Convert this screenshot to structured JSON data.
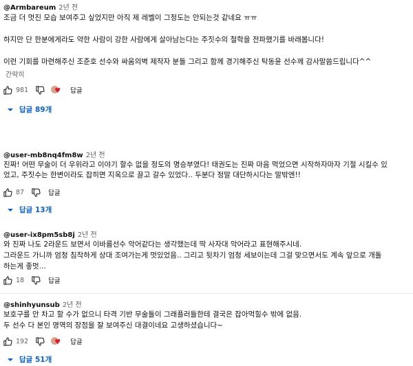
{
  "comments": [
    {
      "author": "@Armbareum",
      "time": "2년 전",
      "lines": [
        "조금 더 멋진 모습 보여주고 싶었지만 아직 제 레벨이 그정도는 안되는것 같네요 ㅠㅠ",
        "하지만 단 한분에게라도 약한 사람이 강한 사람에게 살아남는다는 주짓수의 철학을 전파했기를 바래봅니다!",
        "이런 기회를 마련해주신 조준호 선수와 싸움의벽 제작자 분들 그리고 함께 경기해주신 탁동윤 선수께 감사말씀드립니다^^"
      ],
      "collapse_label": "간략히",
      "likes": "981",
      "reply_label": "답글",
      "replies_label": "답글 89개"
    },
    {
      "author": "@user-mb8nq4fm8w",
      "time": "2년 전",
      "lines": [
        "진짜! 어떤 무술이 더 우위라고 이야기 할수 없을 정도의 명승부였다! 태권도는 진짜 마음 먹었으면 시작하자마자 기절 시킬수 있",
        "었고, 주짓수는 한변이라도 잡히면 지옥으로 끌고 갈수 있었다.. 두분다 정말 대단하시다는 말밖엔!!"
      ],
      "likes": "87",
      "reply_label": "답글",
      "replies_label": "답글 13개"
    },
    {
      "author": "@user-ix8pm5sb8j",
      "time": "2년 전",
      "lines": [
        "와 진짜 나도 2라운드 보면서 이바름선수 악어같다는 생각했는데 딱 사자대 악어라고 표현해주시네.",
        "그라운드 가니까 엄청 침착하게 상대 조여가는게 멋있었음.. 그리고 뒷차기 엄청 세보이는데 그걸 맞으면서도 계속 앞으로 개돌",
        "하는게 좋멋..."
      ],
      "likes": "18",
      "reply_label": "답글"
    },
    {
      "author": "@shinhyunsub",
      "time": "2년 전",
      "lines": [
        "보호구를 안 차고 할 수가 없으니 타격 기반 무술들이 그래플러들한테 결국은 잡아먹힐수 밖에 없음.",
        "두 선수 다 본인 영역의 장점을 잘 보여주신 대결이네요 고생하셨습니다~"
      ],
      "likes": "192",
      "reply_label": "답글",
      "replies_label": "답글 51개"
    }
  ],
  "colors": {
    "link": "#065fd4",
    "meta": "#606060",
    "heart": "#e0182a"
  },
  "icons": [
    "thumbs-up-icon",
    "thumbs-down-icon",
    "creator-heart-icon",
    "chevron-down-icon"
  ]
}
